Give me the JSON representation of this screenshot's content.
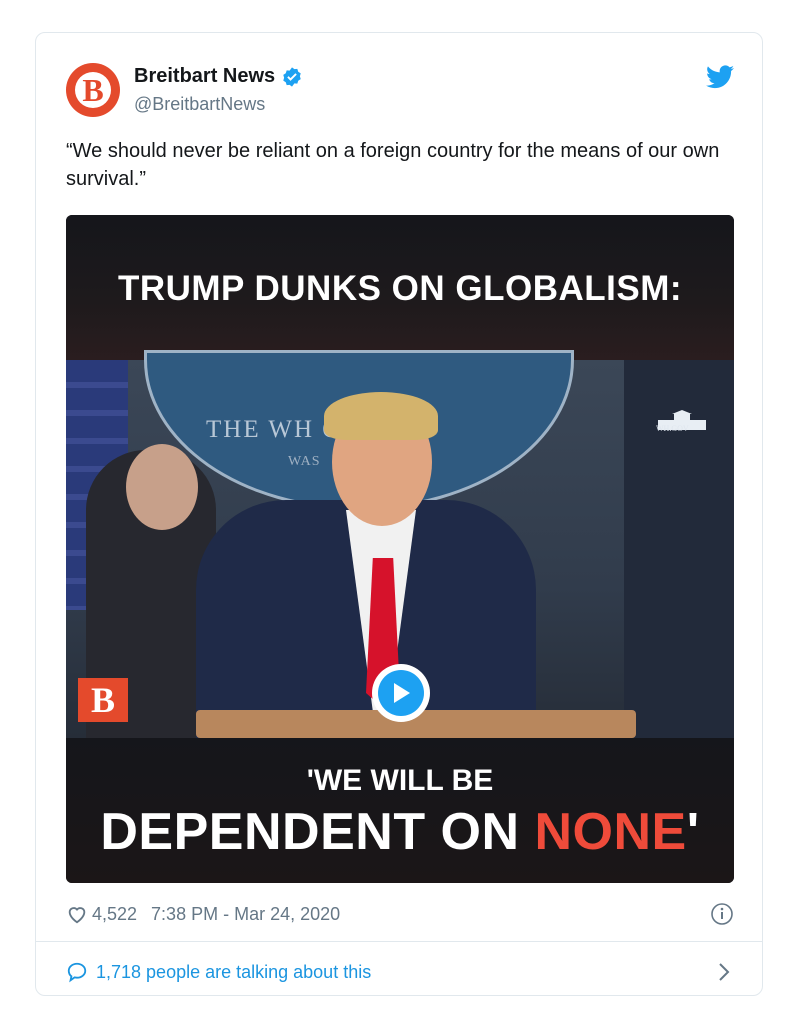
{
  "tweet": {
    "author_name": "Breitbart News",
    "author_handle": "@BreitbartNews",
    "logo_letter": "B",
    "text": "“We should never be reliant on a foreign country for the means of our own survival.”",
    "likes": "4,522",
    "timestamp": "7:38 PM - Mar 24, 2020",
    "conversation": "1,718 people are talking about this"
  },
  "media": {
    "headline_top": "TRUMP DUNKS ON GLOBALISM:",
    "headline_mid": "'WE WILL BE",
    "headline_big_main": "DEPENDENT ON ",
    "headline_big_accent": "NONE",
    "headline_big_tail": "'",
    "seal_text": "THE WH      OUSE",
    "seal_subtext": "WAS",
    "wh_label": "WH.GOV",
    "corner_logo": "B"
  },
  "colors": {
    "brand": "#e44a2c",
    "twitter_blue": "#1da1f2",
    "link_blue": "#1b95e0",
    "muted": "#657786",
    "accent_red": "#ef4b3a"
  },
  "icons": [
    "verified-badge-icon",
    "twitter-bird-icon",
    "heart-icon",
    "info-icon",
    "comment-bubble-icon",
    "chevron-right-icon",
    "play-icon"
  ]
}
